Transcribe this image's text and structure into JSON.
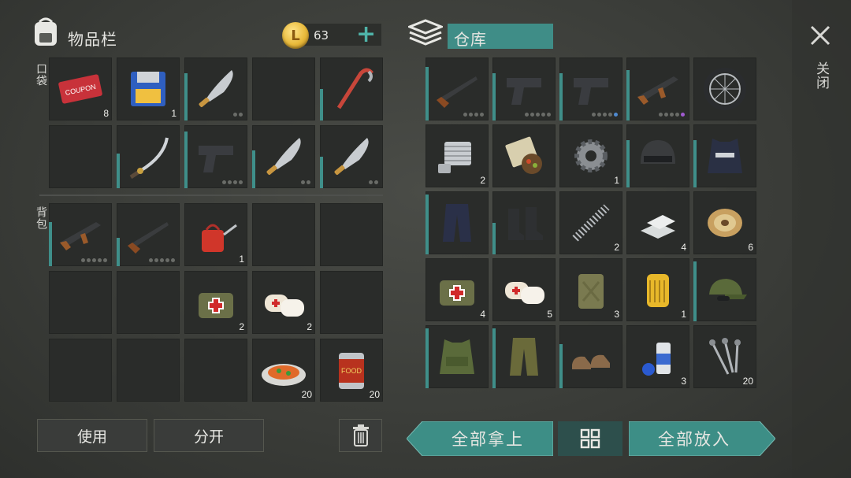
{
  "inventory": {
    "title": "物品栏",
    "pocket_label": "口袋",
    "backpack_label": "背包",
    "coins": "63",
    "pocket": [
      {
        "icon": "coupon-icon",
        "count": "8",
        "dur": 0
      },
      {
        "icon": "floppy-disk-icon",
        "count": "1",
        "dur": 0
      },
      {
        "icon": "machete-icon",
        "count": "",
        "dur": 0.75,
        "dots": 2
      },
      {
        "icon": "",
        "count": "",
        "dur": 0
      },
      {
        "icon": "crowbar-icon",
        "count": "",
        "dur": 0.5
      },
      {
        "icon": "",
        "count": "",
        "dur": 0
      },
      {
        "icon": "katana-icon",
        "count": "",
        "dur": 0.55
      },
      {
        "icon": "pistol-icon",
        "count": "",
        "dur": 0.9,
        "dots": 4
      },
      {
        "icon": "machete-icon",
        "count": "",
        "dur": 0.6,
        "dots": 2
      },
      {
        "icon": "machete-icon",
        "count": "",
        "dur": 0.5,
        "dots": 2
      }
    ],
    "backpack": [
      {
        "icon": "assault-rifle-icon",
        "count": "",
        "dur": 0.7,
        "dots": 5
      },
      {
        "icon": "shotgun-icon",
        "count": "",
        "dur": 0.45,
        "dots": 5
      },
      {
        "icon": "oil-can-icon",
        "count": "1",
        "dur": 0
      },
      {
        "icon": "",
        "count": "",
        "dur": 0
      },
      {
        "icon": "",
        "count": "",
        "dur": 0
      },
      {
        "icon": "",
        "count": "",
        "dur": 0
      },
      {
        "icon": "",
        "count": "",
        "dur": 0
      },
      {
        "icon": "first-aid-bag-icon",
        "count": "2",
        "dur": 0
      },
      {
        "icon": "bandage-icon",
        "count": "2",
        "dur": 0
      },
      {
        "icon": "",
        "count": "",
        "dur": 0
      },
      {
        "icon": "",
        "count": "",
        "dur": 0
      },
      {
        "icon": "",
        "count": "",
        "dur": 0
      },
      {
        "icon": "",
        "count": "",
        "dur": 0
      },
      {
        "icon": "food-plate-icon",
        "count": "20",
        "dur": 0
      },
      {
        "icon": "canned-food-icon",
        "count": "20",
        "dur": 0
      }
    ],
    "use_label": "使用",
    "split_label": "分开"
  },
  "storage": {
    "title": "仓库",
    "items": [
      {
        "icon": "shotgun-icon",
        "count": "",
        "dur": 0.85,
        "dots": 4
      },
      {
        "icon": "pistol-icon",
        "count": "",
        "dur": 0.75,
        "dots": 5
      },
      {
        "icon": "pistol-icon",
        "count": "",
        "dur": 0.75,
        "dots": 4,
        "accent": "blue"
      },
      {
        "icon": "assault-rifle-icon",
        "count": "",
        "dur": 0.8,
        "dots": 4,
        "accent": "purple"
      },
      {
        "icon": "wheel-icon",
        "count": "",
        "dur": 0
      },
      {
        "icon": "engine-part-icon",
        "count": "2",
        "dur": 0
      },
      {
        "icon": "seeds-icon",
        "count": "",
        "dur": 0
      },
      {
        "icon": "gear-icon",
        "count": "1",
        "dur": 0
      },
      {
        "icon": "helmet-icon",
        "count": "",
        "dur": 0.75
      },
      {
        "icon": "police-vest-icon",
        "count": "",
        "dur": 0.75
      },
      {
        "icon": "police-pants-icon",
        "count": "",
        "dur": 0.95
      },
      {
        "icon": "boots-icon",
        "count": "",
        "dur": 0.5
      },
      {
        "icon": "spring-icon",
        "count": "2",
        "dur": 0
      },
      {
        "icon": "metal-bars-icon",
        "count": "4",
        "dur": 0
      },
      {
        "icon": "wire-spool-icon",
        "count": "6",
        "dur": 0
      },
      {
        "icon": "first-aid-bag-icon",
        "count": "4",
        "dur": 0
      },
      {
        "icon": "bandage-icon",
        "count": "5",
        "dur": 0
      },
      {
        "icon": "jerrycan-icon",
        "count": "3",
        "dur": 0
      },
      {
        "icon": "oil-filter-icon",
        "count": "1",
        "dur": 0
      },
      {
        "icon": "camo-cap-icon",
        "count": "",
        "dur": 0.95
      },
      {
        "icon": "camo-vest-icon",
        "count": "",
        "dur": 0.95
      },
      {
        "icon": "camo-pants-icon",
        "count": "",
        "dur": 0.95
      },
      {
        "icon": "shoes-icon",
        "count": "",
        "dur": 0.7
      },
      {
        "icon": "spray-paint-icon",
        "count": "3",
        "dur": 0
      },
      {
        "icon": "nails-icon",
        "count": "20",
        "dur": 0
      }
    ],
    "take_all_label": "全部拿上",
    "put_all_label": "全部放入"
  },
  "close_label": "关闭",
  "colors": {
    "accent": "#3f8f8a",
    "cell": "#2a2c2a",
    "gold": "#e8b93a"
  }
}
